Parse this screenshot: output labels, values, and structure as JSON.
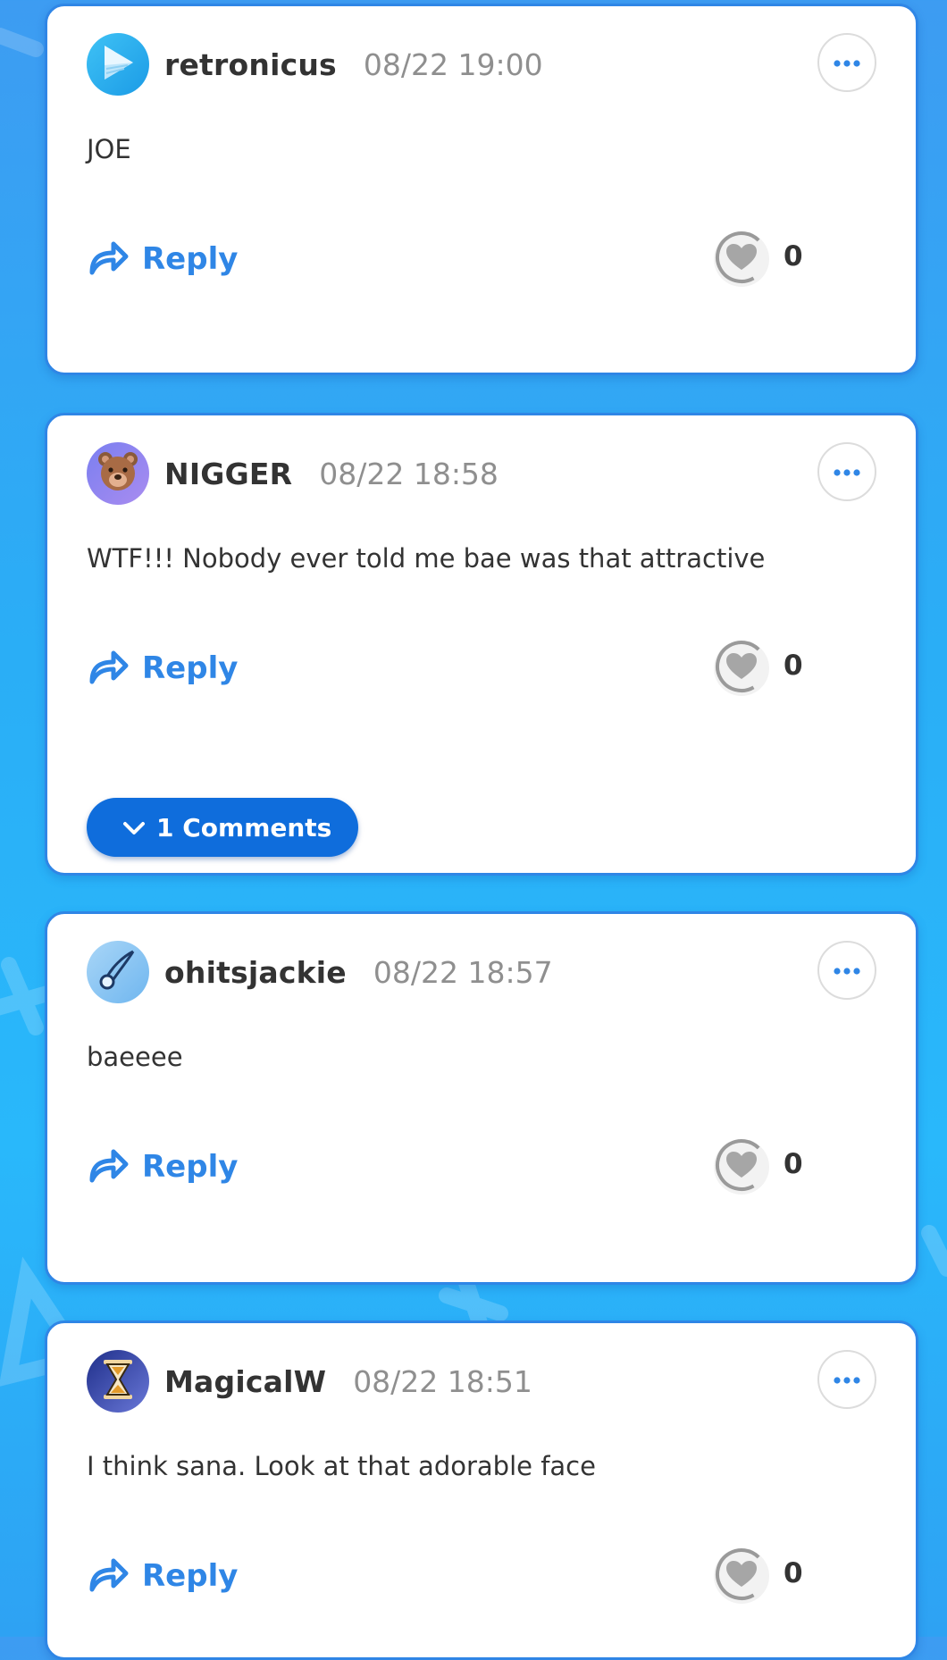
{
  "colors": {
    "accent": "#2f86e6",
    "comments_button": "#0f6ddc",
    "username": "#333333",
    "timestamp": "#8f8f8f"
  },
  "comments": [
    {
      "username": "retronicus",
      "timestamp": "08/22 19:00",
      "text": "JOE",
      "avatar_icon": "play-logo-icon",
      "reply_label": "Reply",
      "likes": "0"
    },
    {
      "username": "NIGGER",
      "timestamp": "08/22 18:58",
      "text": "WTF!!! Nobody ever told me bae was that attractive",
      "avatar_icon": "bear-face-icon",
      "reply_label": "Reply",
      "likes": "0",
      "replies_label": "1 Comments"
    },
    {
      "username": "ohitsjackie",
      "timestamp": "08/22 18:57",
      "text": "baeeee",
      "avatar_icon": "comet-icon",
      "reply_label": "Reply",
      "likes": "0"
    },
    {
      "username": "MagicalW",
      "timestamp": "08/22 18:51",
      "text": "I think sana. Look at that adorable face",
      "avatar_icon": "hourglass-icon",
      "reply_label": "Reply",
      "likes": "0"
    }
  ]
}
